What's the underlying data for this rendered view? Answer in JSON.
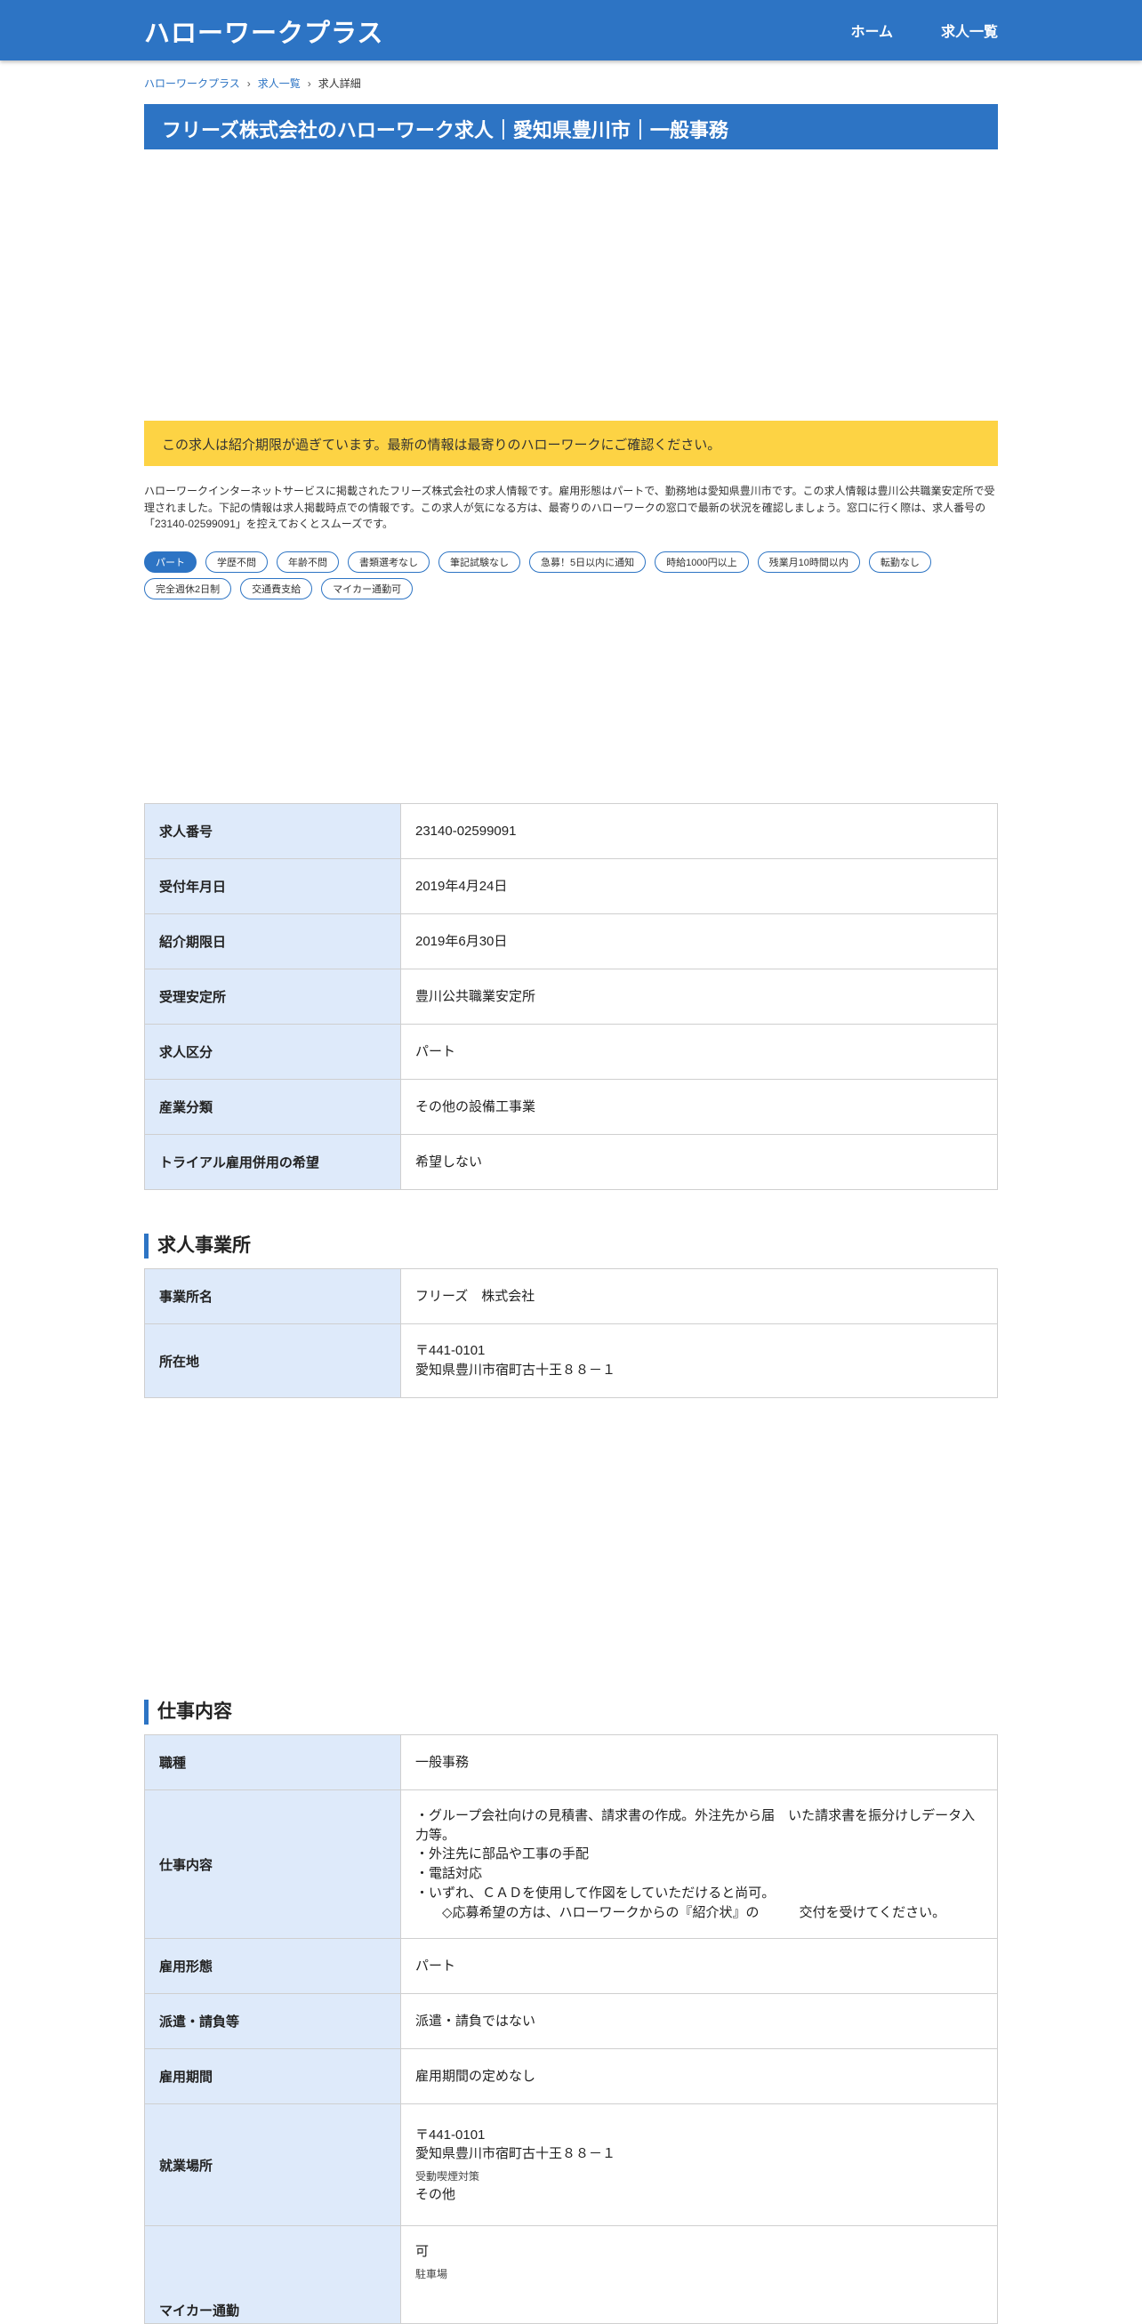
{
  "header": {
    "site_title": "ハローワークプラス",
    "nav": [
      "ホーム",
      "求人一覧"
    ]
  },
  "breadcrumb": [
    "ハローワークプラス",
    "求人一覧",
    "求人詳細"
  ],
  "page_title": "フリーズ株式会社のハローワーク求人｜愛知県豊川市｜一般事務",
  "notice": "この求人は紹介期限が過ぎています。最新の情報は最寄りのハローワークにご確認ください。",
  "description": "ハローワークインターネットサービスに掲載されたフリーズ株式会社の求人情報です。雇用形態はパートで、勤務地は愛知県豊川市です。この求人情報は豊川公共職業安定所で受理されました。下記の情報は求人掲載時点での情報です。この求人が気になる方は、最寄りのハローワークの窓口で最新の状況を確認しましょう。窓口に行く際は、求人番号の「23140-02599091」を控えておくとスムーズです。",
  "tags": [
    "パート",
    "学歴不問",
    "年齢不問",
    "書類選考なし",
    "筆記試験なし",
    "急募！5日以内に通知",
    "時給1000円以上",
    "残業月10時間以内",
    "転勤なし",
    "完全週休2日制",
    "交通費支給",
    "マイカー通勤可"
  ],
  "basic_info": {
    "rows": [
      {
        "label": "求人番号",
        "value": "23140-02599091"
      },
      {
        "label": "受付年月日",
        "value": "2019年4月24日"
      },
      {
        "label": "紹介期限日",
        "value": "2019年6月30日"
      },
      {
        "label": "受理安定所",
        "value": "豊川公共職業安定所"
      },
      {
        "label": "求人区分",
        "value": "パート"
      },
      {
        "label": "産業分類",
        "value": "その他の設備工事業"
      },
      {
        "label": "トライアル雇用併用の希望",
        "value": "希望しない"
      }
    ]
  },
  "office": {
    "heading": "求人事業所",
    "name_label": "事業所名",
    "name_value": "フリーズ　株式会社",
    "address_label": "所在地",
    "postal": "〒441-0101",
    "address": "愛知県豊川市宿町古十王８８－１"
  },
  "job": {
    "heading": "仕事内容",
    "title_label": "職種",
    "title_value": "一般事務",
    "content_label": "仕事内容",
    "content_lines": [
      "・グループ会社向けの見積書、請求書の作成。外注先から届　いた請求書を振分けしデータ入力等。",
      "・外注先に部品や工事の手配",
      "・電話対応",
      "・いずれ、ＣＡＤを使用して作図をしていただけると尚可。",
      "　　◇応募希望の方は、ハローワークからの『紹介状』の　　　交付を受けてください。"
    ],
    "employment_label": "雇用形態",
    "employment_value": "パート",
    "dispatch_label": "派遣・請負等",
    "dispatch_value": "派遣・請負ではない",
    "period_label": "雇用期間",
    "period_value": "雇用期間の定めなし",
    "workplace_label": "就業場所",
    "workplace_postal": "〒441-0101",
    "workplace_address": "愛知県豊川市宿町古十王８８－１",
    "smoke_label": "受動喫煙対策",
    "smoke_value": "その他",
    "car_label": "マイカー通勤",
    "car_value": "可",
    "parking_label": "駐車場"
  }
}
